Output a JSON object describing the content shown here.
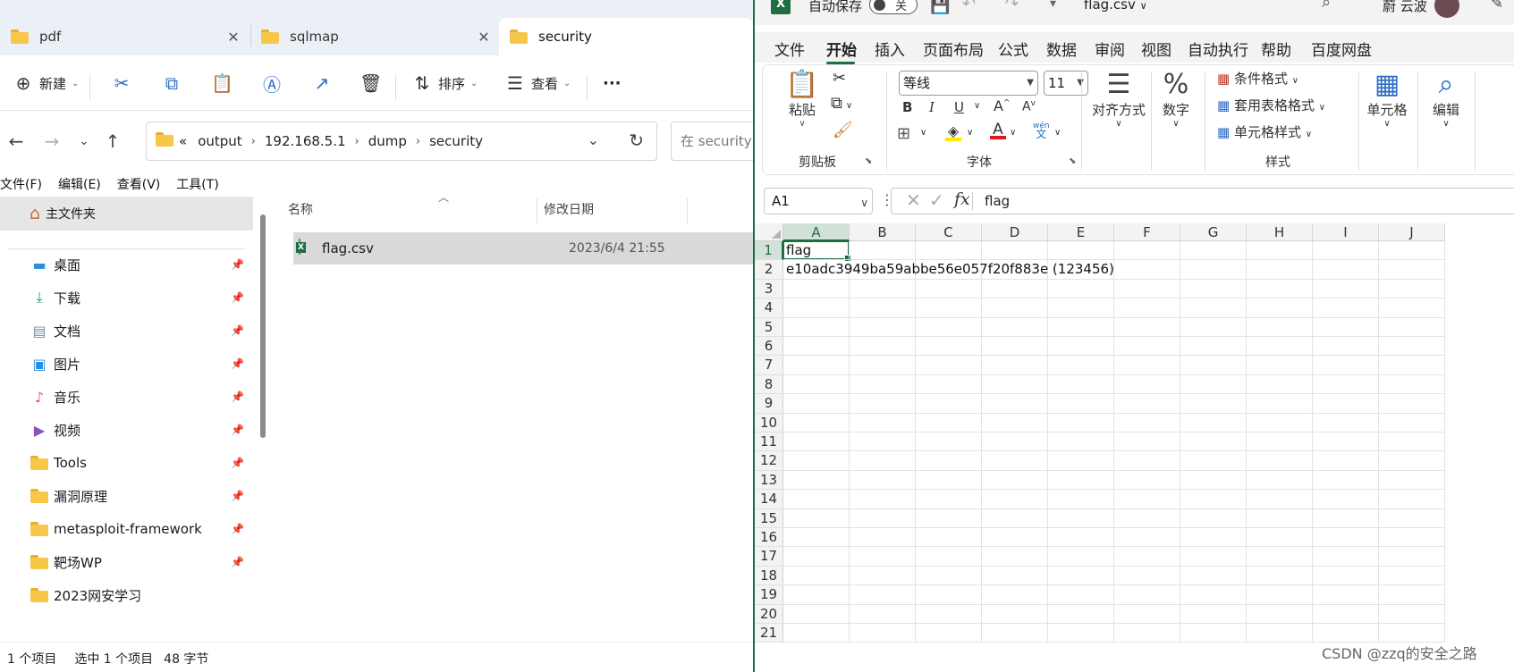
{
  "explorer": {
    "tabs": [
      {
        "label": "pdf",
        "close": "✕"
      },
      {
        "label": "sqlmap",
        "close": "✕"
      },
      {
        "label": "security"
      }
    ],
    "toolbar": {
      "new_label": "新建",
      "sort_label": "排序",
      "view_label": "查看",
      "more_label": "···"
    },
    "address": {
      "prefix": "«",
      "crumbs": [
        "output",
        "192.168.5.1",
        "dump",
        "security"
      ],
      "search_placeholder": "在 security"
    },
    "menu": [
      "文件(F)",
      "编辑(E)",
      "查看(V)",
      "工具(T)"
    ],
    "sidebar": {
      "home_label": "主文件夹",
      "items": [
        {
          "label": "桌面",
          "icon": "desktop-icon",
          "color": "#2b8de0"
        },
        {
          "label": "下载",
          "icon": "download-icon",
          "color": "#1f9e6b"
        },
        {
          "label": "文档",
          "icon": "document-icon",
          "color": "#7a8ea8"
        },
        {
          "label": "图片",
          "icon": "picture-icon",
          "color": "#2b8de0"
        },
        {
          "label": "音乐",
          "icon": "music-icon",
          "color": "#e2586a"
        },
        {
          "label": "视频",
          "icon": "video-icon",
          "color": "#8c4fc4"
        },
        {
          "label": "Tools",
          "icon": "folder-icon",
          "color": "#f7c74a"
        },
        {
          "label": "漏洞原理",
          "icon": "folder-icon",
          "color": "#f7c74a"
        },
        {
          "label": "metasploit-framework",
          "icon": "folder-icon",
          "color": "#f7c74a"
        },
        {
          "label": "靶场WP",
          "icon": "folder-icon",
          "color": "#f7c74a"
        },
        {
          "label": "2023网安学习",
          "icon": "folder-icon",
          "color": "#f7c74a"
        }
      ]
    },
    "columns": {
      "name": "名称",
      "date": "修改日期"
    },
    "file": {
      "name": "flag.csv",
      "date": "2023/6/4 21:55"
    },
    "status": {
      "count": "1 个项目",
      "selected": "选中 1 个项目",
      "size": "48 字节"
    }
  },
  "excel": {
    "autosave_label": "自动保存",
    "toggle_state": "关",
    "filename": "flag.csv",
    "user_name": "蔚 云波",
    "tabs": [
      "文件",
      "开始",
      "插入",
      "页面布局",
      "公式",
      "数据",
      "审阅",
      "视图",
      "自动执行",
      "帮助",
      "百度网盘"
    ],
    "active_tab": "开始",
    "ribbon": {
      "paste_label": "粘贴",
      "clipboard_group": "剪贴板",
      "font_name": "等线",
      "font_size": "11",
      "font_group": "字体",
      "align_label": "对齐方式",
      "number_label": "数字",
      "cond_format": "条件格式",
      "table_format": "套用表格格式",
      "cell_style": "单元格样式",
      "styles_group": "样式",
      "cells_label": "单元格",
      "edit_label": "编辑",
      "phonetic_top": "wén",
      "phonetic_bottom": "文",
      "bold": "B",
      "italic": "I",
      "underline": "U"
    },
    "namebox": "A1",
    "formula": "flag",
    "columns": [
      "A",
      "B",
      "C",
      "D",
      "E",
      "F",
      "G",
      "H",
      "I",
      "J"
    ],
    "rows": [
      "1",
      "2",
      "3",
      "4",
      "5",
      "6",
      "7",
      "8",
      "9",
      "10",
      "11",
      "12",
      "13",
      "14",
      "15",
      "16",
      "17",
      "18",
      "19",
      "20",
      "21"
    ],
    "cells": {
      "A1": "flag",
      "A2": "e10adc3949ba59abbe56e057f20f883e (123456)"
    }
  },
  "watermark": "CSDN @zzq的安全之路",
  "colors": {
    "excel_green": "#1d6f42",
    "folder_yellow": "#f7c74a",
    "selection_gray": "#d9d9d9"
  }
}
